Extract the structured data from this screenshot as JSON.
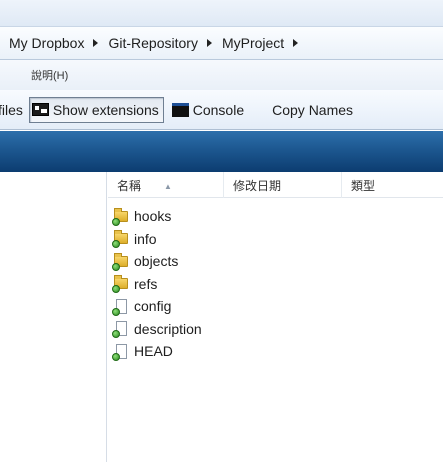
{
  "address_bar": {
    "crumbs": [
      "My Dropbox",
      "Git-Repository",
      "MyProject"
    ]
  },
  "menu": {
    "help": "說明(H)"
  },
  "toolbar": {
    "files_label": "files",
    "show_extensions_label": "Show extensions",
    "console_label": "Console",
    "copy_names_label": "Copy Names"
  },
  "columns": {
    "name": "名稱",
    "date_modified": "修改日期",
    "type": "類型"
  },
  "files": [
    {
      "name": "hooks",
      "kind": "folder"
    },
    {
      "name": "info",
      "kind": "folder"
    },
    {
      "name": "objects",
      "kind": "folder"
    },
    {
      "name": "refs",
      "kind": "folder"
    },
    {
      "name": "config",
      "kind": "file"
    },
    {
      "name": "description",
      "kind": "file"
    },
    {
      "name": "HEAD",
      "kind": "file"
    }
  ],
  "icons": {
    "folder": "folder-synced-icon",
    "file": "file-synced-icon"
  },
  "colors": {
    "band": "#1e5a93",
    "sync_badge": "#2a8a1e"
  }
}
